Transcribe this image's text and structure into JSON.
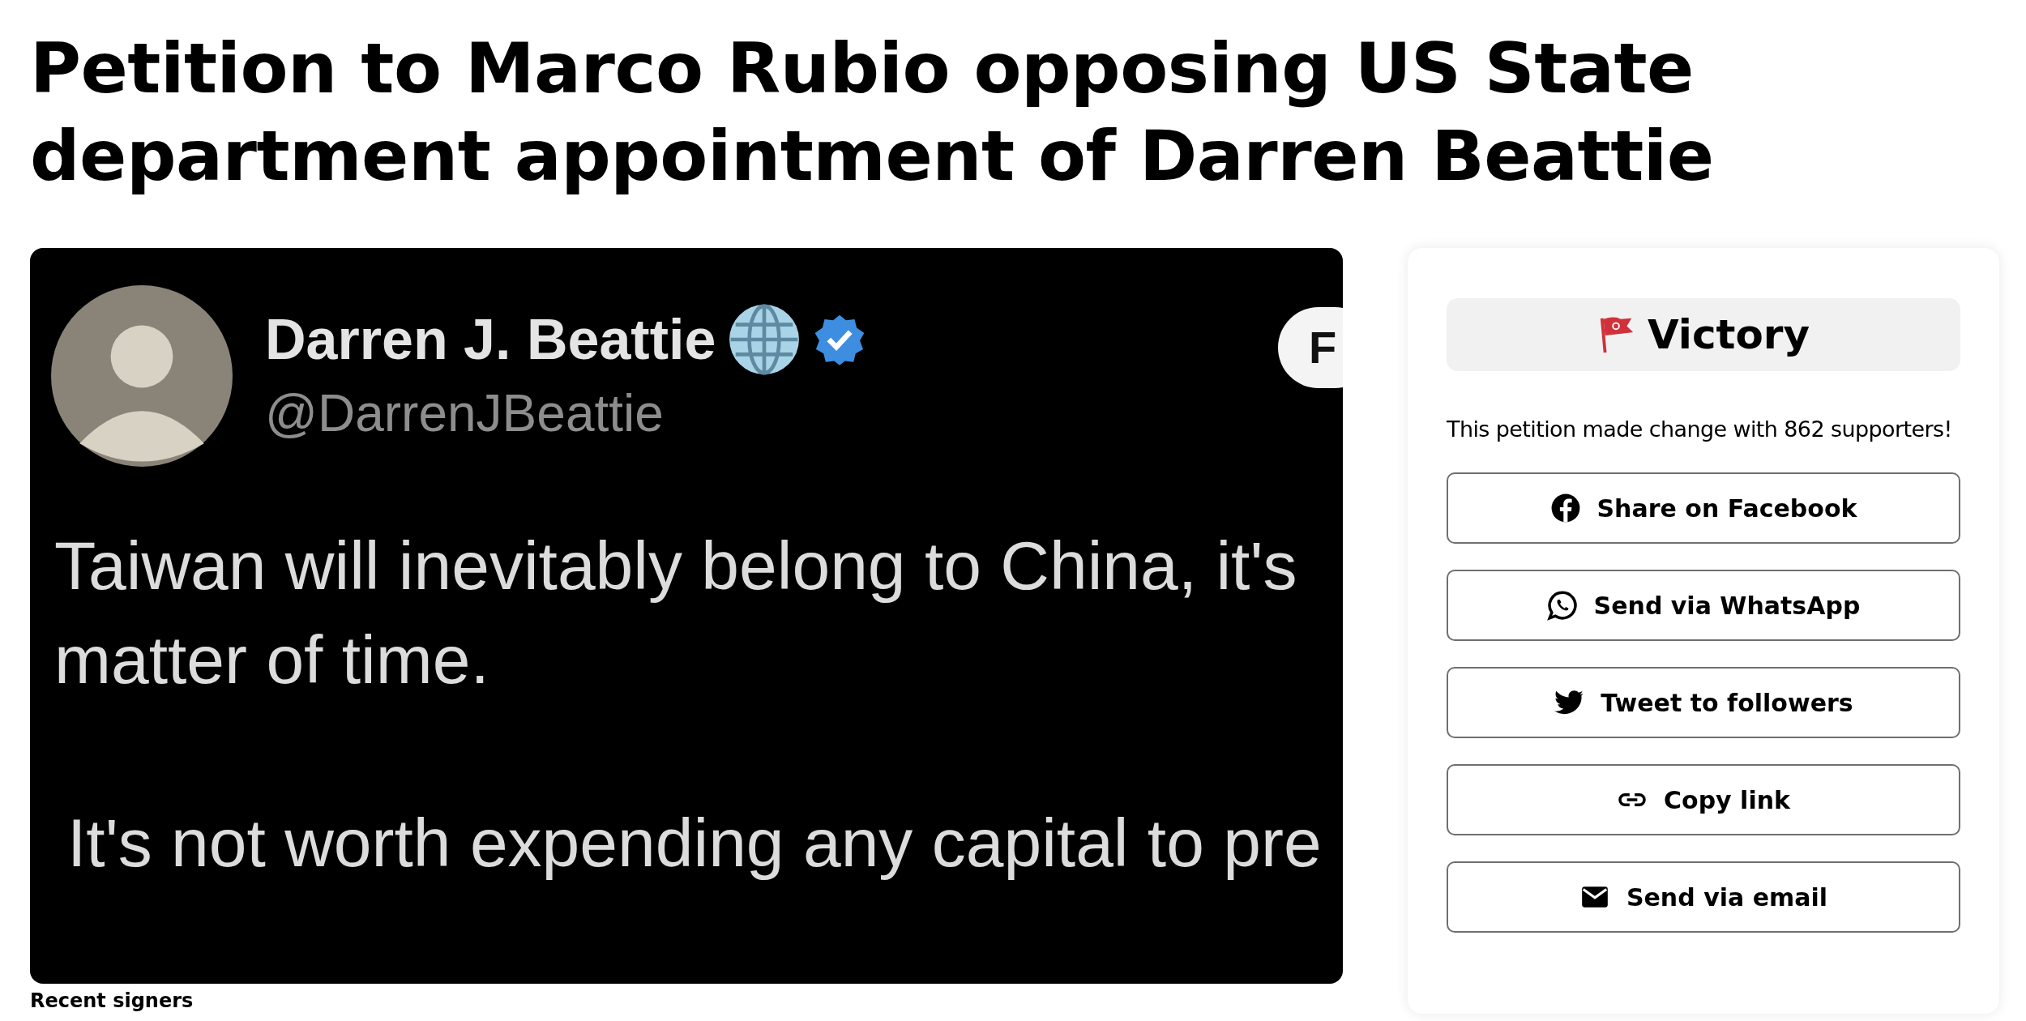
{
  "title": "Petition to Marco Rubio opposing US State department appointment of Darren Beattie",
  "tweet": {
    "author": {
      "name": "Darren J. Beattie",
      "handle": "@DarrenJBeattie"
    },
    "button": "F",
    "paragraphs": [
      [
        "Taiwan will inevitably belong to China, it's",
        "matter of time."
      ],
      [
        "It's not worth expending any capital to pre"
      ]
    ]
  },
  "sidebar": {
    "status": "Victory",
    "message": "This petition made change with 862 supporters!",
    "share_buttons": [
      {
        "kind": "facebook",
        "label": "Share on Facebook"
      },
      {
        "kind": "whatsapp",
        "label": "Send via WhatsApp"
      },
      {
        "kind": "twitter",
        "label": "Tweet to followers"
      },
      {
        "kind": "link",
        "label": "Copy link"
      },
      {
        "kind": "email",
        "label": "Send via email"
      }
    ]
  },
  "recent_signers": {
    "heading": "Recent signers"
  }
}
